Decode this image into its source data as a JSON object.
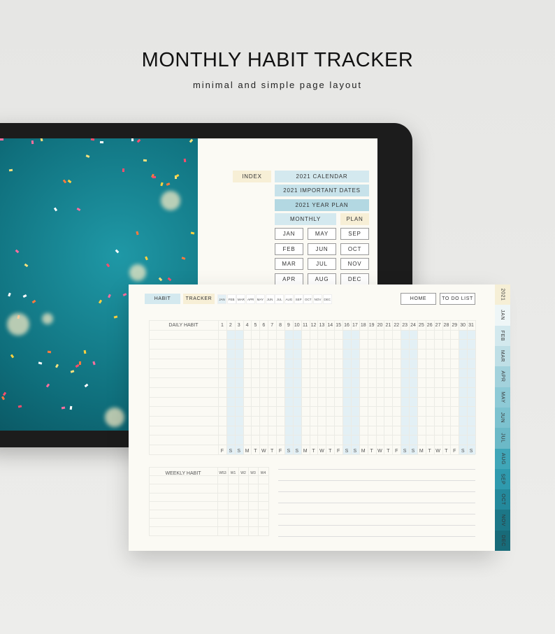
{
  "header": {
    "title": "MONTHLY HABIT TRACKER",
    "subtitle": "minimal and simple page layout"
  },
  "index_page": {
    "index": "INDEX",
    "calendar": "2021 CALENDAR",
    "important": "2021 IMPORTANT DATES",
    "year_plan": "2021 YEAR PLAN",
    "monthly": "MONTHLY",
    "plan": "PLAN",
    "months": [
      "JAN",
      "MAY",
      "SEP",
      "FEB",
      "JUN",
      "OCT",
      "MAR",
      "JUL",
      "NOV",
      "APR",
      "AUG",
      "DEC"
    ]
  },
  "tracker": {
    "habit": "HABIT",
    "tracker": "TRACKER",
    "month_tabs": [
      "JAN",
      "FEB",
      "MAR",
      "APR",
      "MAY",
      "JUN",
      "JUL",
      "AUG",
      "SEP",
      "OCT",
      "NOV",
      "DEC"
    ],
    "active_month": "JAN",
    "home": "HOME",
    "todo": "TO DO LIST",
    "daily_label": "DAILY HABIT",
    "days": [
      "1",
      "2",
      "3",
      "4",
      "5",
      "6",
      "7",
      "8",
      "9",
      "10",
      "11",
      "12",
      "13",
      "14",
      "15",
      "16",
      "17",
      "18",
      "19",
      "20",
      "21",
      "22",
      "23",
      "24",
      "25",
      "26",
      "27",
      "28",
      "29",
      "30",
      "31"
    ],
    "weekdays": [
      "F",
      "S",
      "S",
      "M",
      "T",
      "W",
      "T",
      "F",
      "S",
      "S",
      "M",
      "T",
      "W",
      "T",
      "F",
      "S",
      "S",
      "M",
      "T",
      "W",
      "T",
      "F",
      "S",
      "S",
      "M",
      "T",
      "W",
      "T",
      "F",
      "S",
      "S"
    ],
    "weekly_label": "WEEKLY HABIT",
    "weeks": [
      "W53",
      "W1",
      "W2",
      "W3",
      "W4"
    ]
  },
  "side_tabs": [
    {
      "label": "2021",
      "color": "#f6efd6"
    },
    {
      "label": "JAN",
      "color": "#eef6f7"
    },
    {
      "label": "FEB",
      "color": "#d3e9ee"
    },
    {
      "label": "MAR",
      "color": "#bfdfe6"
    },
    {
      "label": "APR",
      "color": "#a3d2dc"
    },
    {
      "label": "MAY",
      "color": "#8ecad6"
    },
    {
      "label": "JUN",
      "color": "#7dc2cf"
    },
    {
      "label": "JUL",
      "color": "#6cb9c7"
    },
    {
      "label": "AUG",
      "color": "#40a6b8"
    },
    {
      "label": "SEP",
      "color": "#2f9aae"
    },
    {
      "label": "OCT",
      "color": "#24899c"
    },
    {
      "label": "NOV",
      "color": "#1c7787"
    },
    {
      "label": "DEC",
      "color": "#186b79"
    }
  ],
  "colors": {
    "blue": "#d4e9ef",
    "cream": "#f7efd6",
    "weekend": "#e3f0f5"
  }
}
